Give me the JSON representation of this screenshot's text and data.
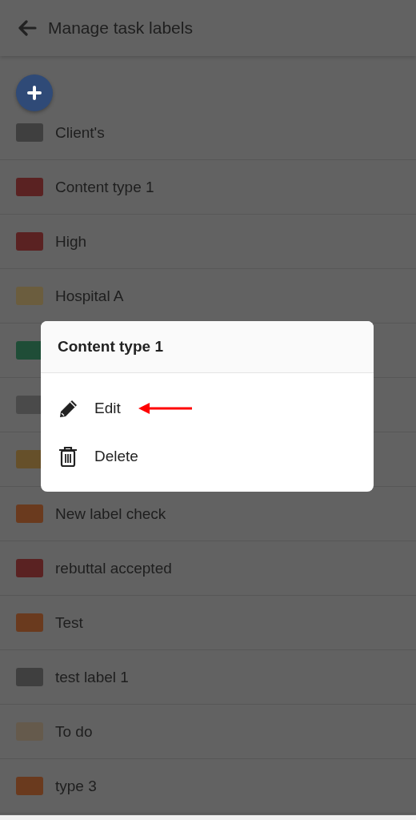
{
  "app_bar": {
    "title": "Manage task labels"
  },
  "labels": [
    {
      "name": "Client's",
      "color": "#3f3f3f"
    },
    {
      "name": "Content type 1",
      "color": "#5a2222"
    },
    {
      "name": "High",
      "color": "#5a2222"
    },
    {
      "name": "Hospital A",
      "color": "#6b5d3e"
    },
    {
      "color": "#1f4d37"
    },
    {
      "color": "#4a4a4a"
    },
    {
      "color": "#66502a"
    },
    {
      "name": "New label check",
      "color": "#6a3a1e"
    },
    {
      "name": "rebuttal accepted",
      "color": "#5a2222"
    },
    {
      "name": "Test",
      "color": "#6a3a1e"
    },
    {
      "name": "test label 1",
      "color": "#3f3f3f"
    },
    {
      "name": "To do",
      "color": "#655a4c"
    },
    {
      "name": "type 3",
      "color": "#6a3a1e"
    }
  ],
  "dialog": {
    "title": "Content type 1",
    "actions": [
      {
        "kind": "edit",
        "label": "Edit",
        "annotated": true
      },
      {
        "kind": "delete",
        "label": "Delete",
        "annotated": false
      }
    ]
  }
}
